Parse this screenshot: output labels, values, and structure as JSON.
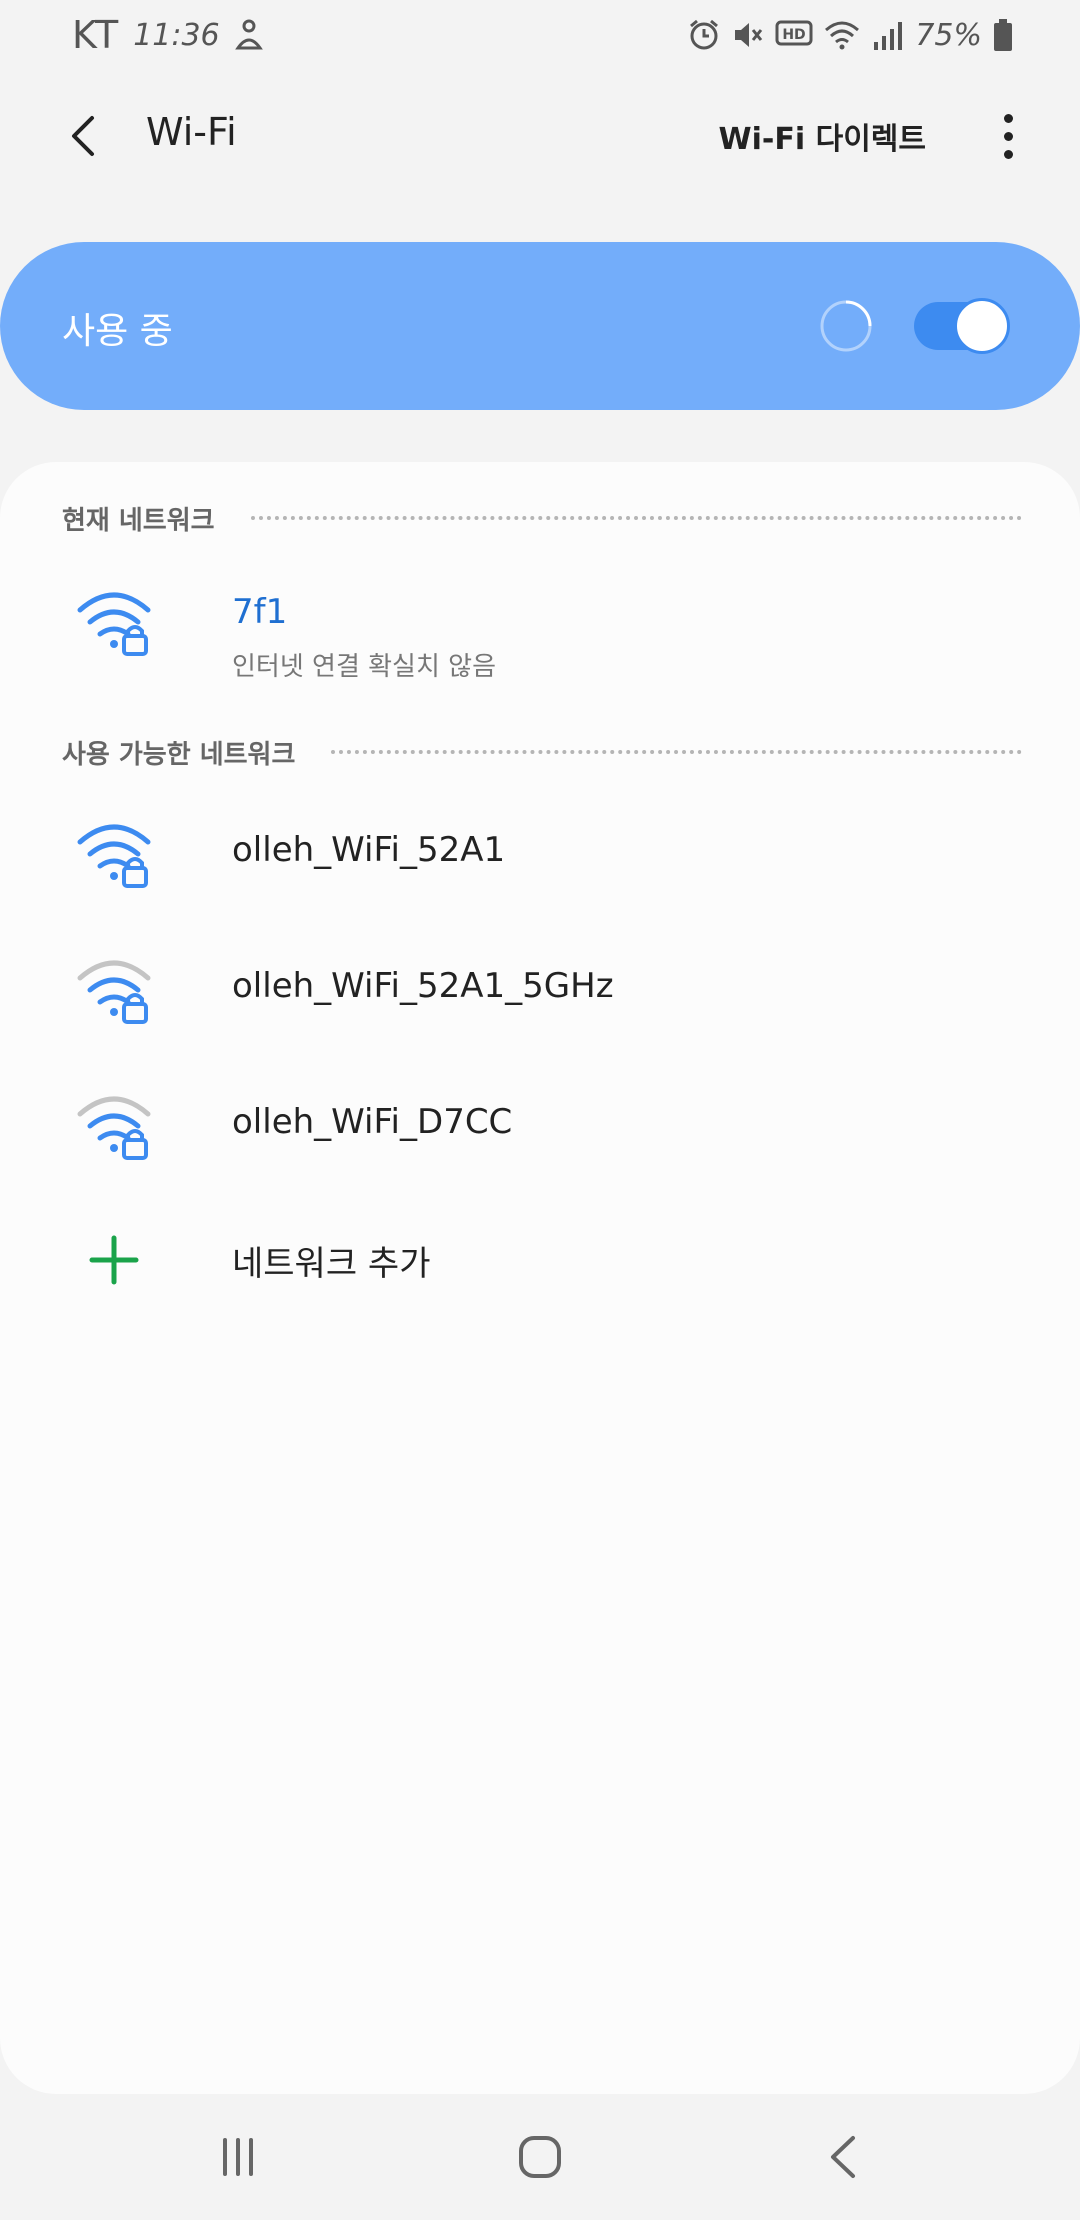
{
  "status_bar": {
    "carrier": "KT",
    "time": "11:36",
    "battery": "75%"
  },
  "app_bar": {
    "title": "Wi-Fi",
    "wifi_direct_label": "Wi-Fi 다이렉트"
  },
  "master_switch": {
    "label": "사용 중",
    "on": true
  },
  "current_network": {
    "header": "현재 네트워크",
    "name": "7f1",
    "status": "인터넷 연결 확실치 않음"
  },
  "available_networks": {
    "header": "사용 가능한 네트워크",
    "items": [
      {
        "name": "olleh_WiFi_52A1",
        "signal_bars": 3,
        "secured": true
      },
      {
        "name": "olleh_WiFi_52A1_5GHz",
        "signal_bars": 2,
        "secured": true
      },
      {
        "name": "olleh_WiFi_D7CC",
        "signal_bars": 2,
        "secured": true
      }
    ]
  },
  "add_network": {
    "label": "네트워크 추가"
  },
  "colors": {
    "accent": "#3d8bf0",
    "toggle_card": "#73adfa",
    "current_network_name": "#1f6fd1",
    "add_icon": "#1aa34a",
    "signal_off": "#c4c4c4"
  },
  "icons": {
    "back": "chevron-left-icon",
    "more": "more-vert-icon",
    "wifi": "wifi-lock-icon",
    "add": "plus-icon"
  }
}
